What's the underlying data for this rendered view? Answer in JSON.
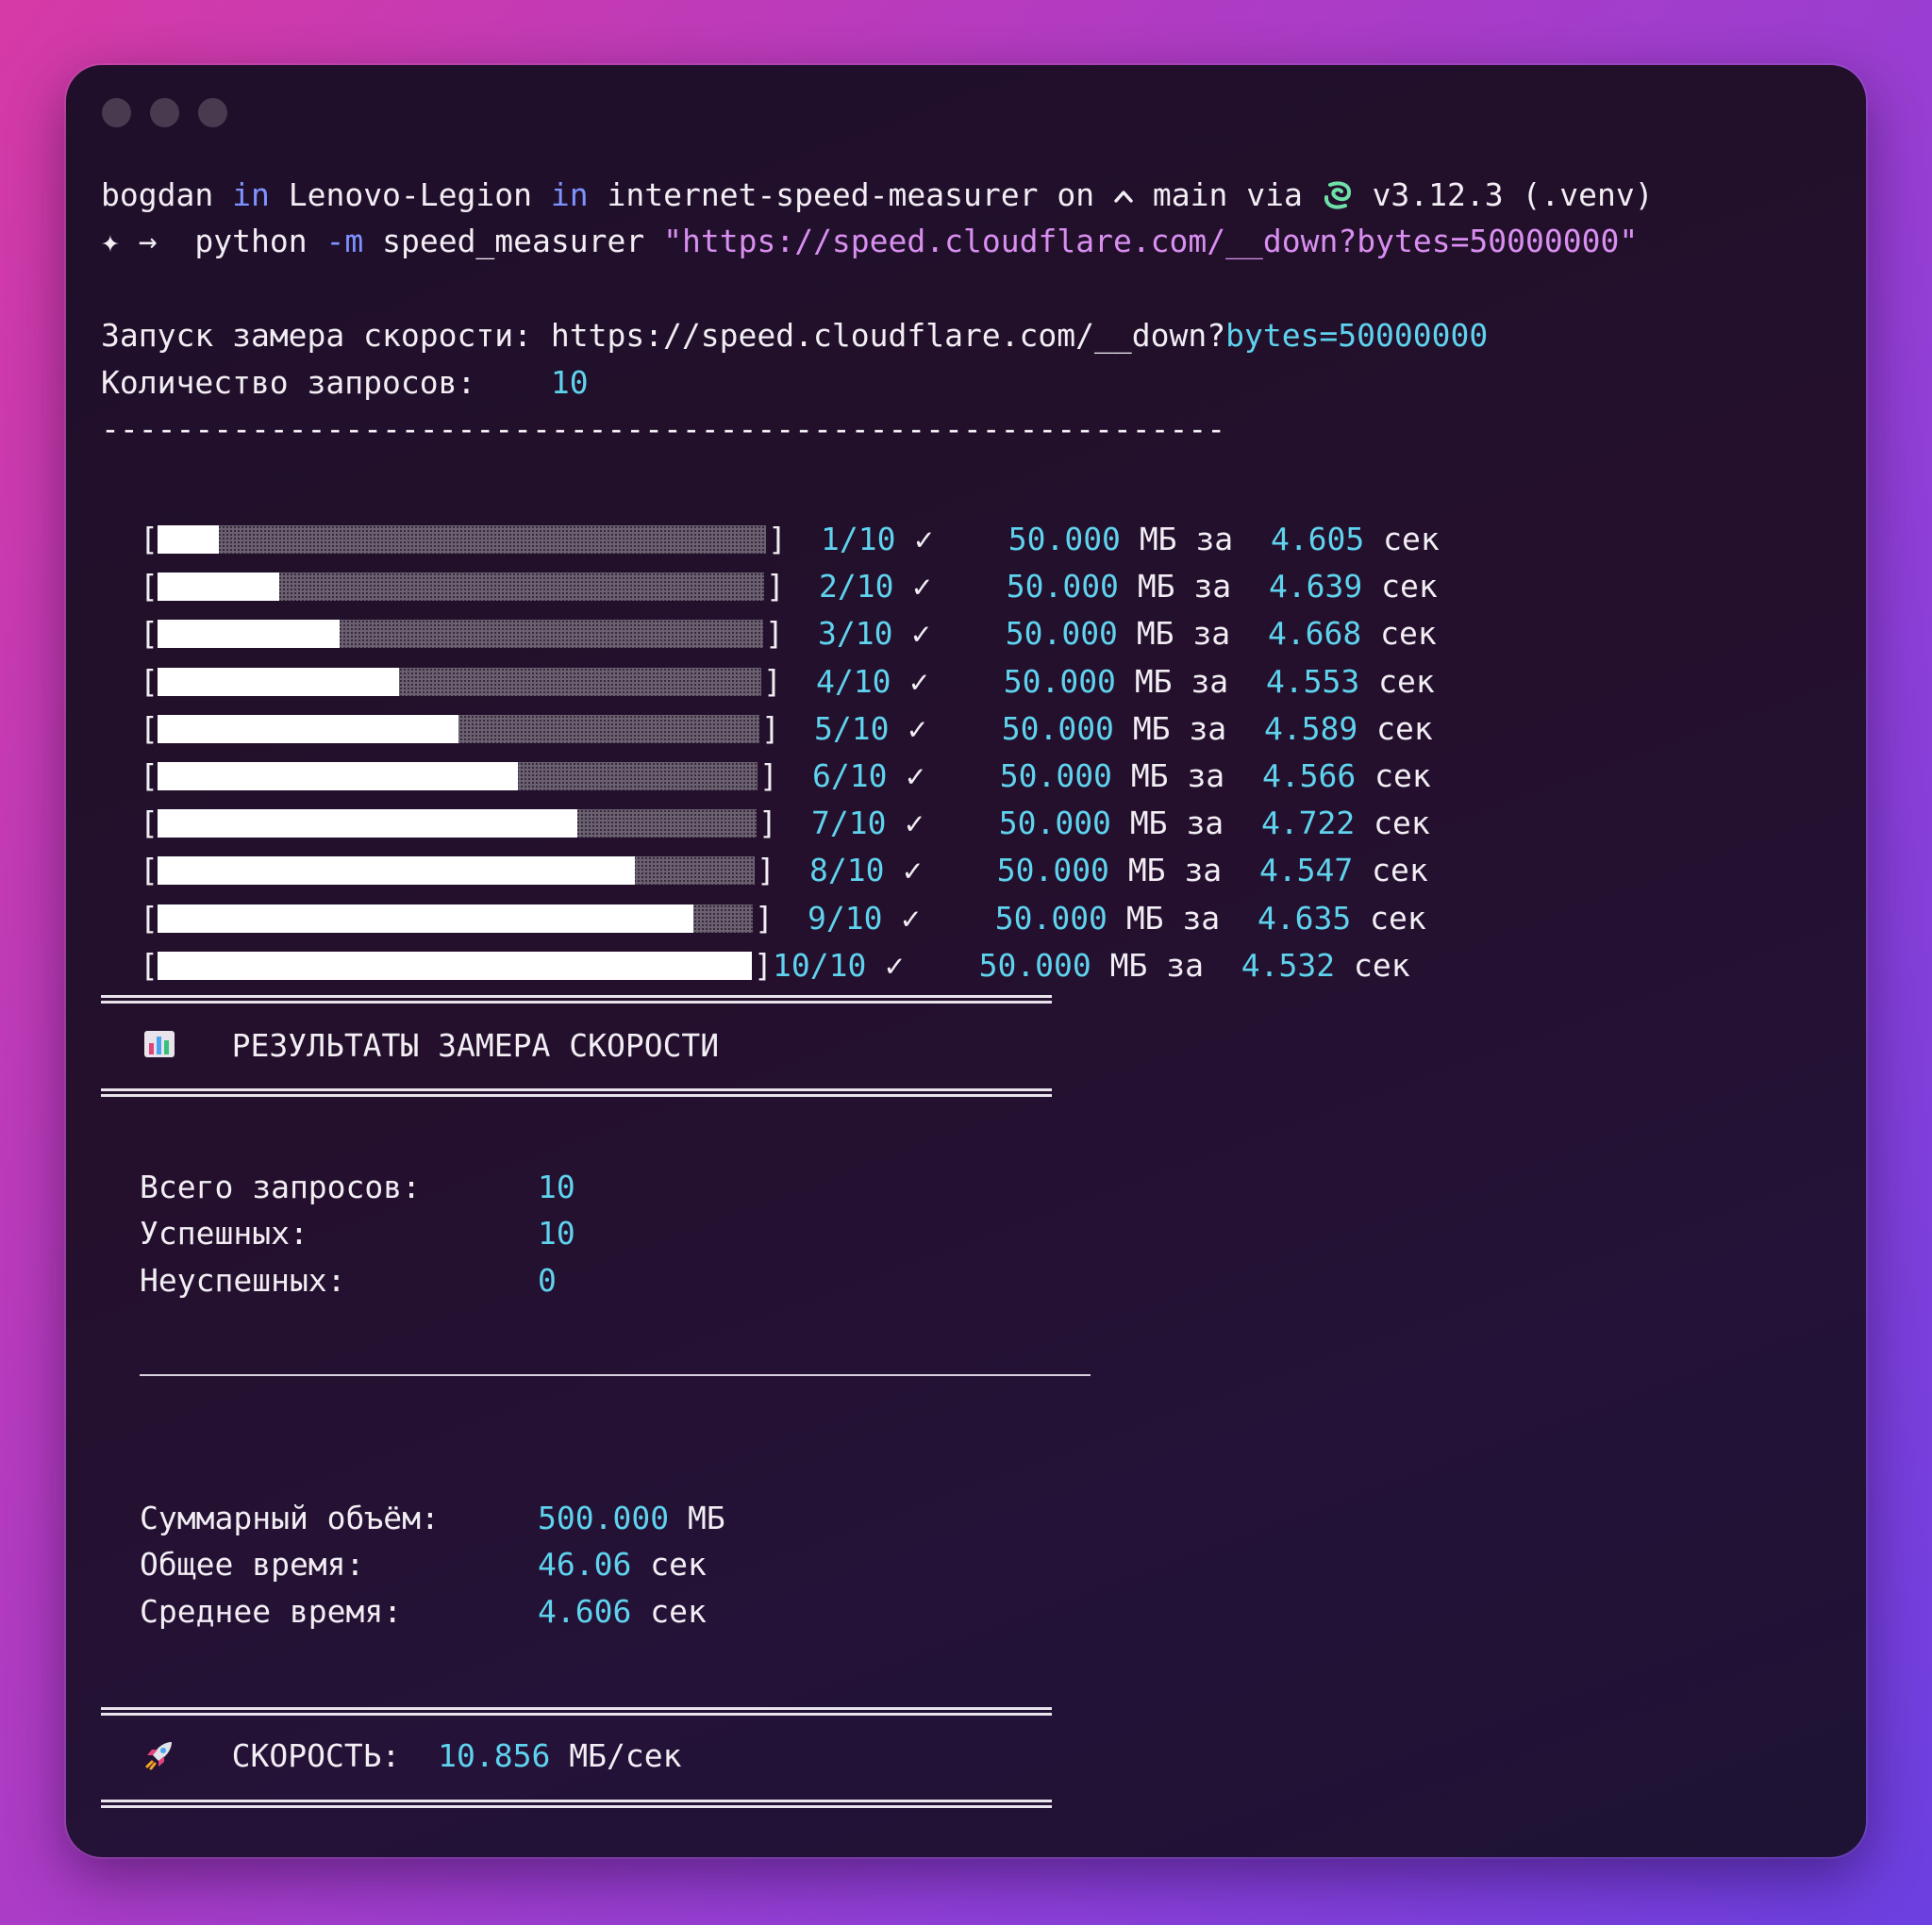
{
  "prompt": {
    "user": "bogdan",
    "in1": "in",
    "host": "Lenovo-Legion",
    "in2": "in",
    "dir": "internet-speed-measurer",
    "on": "on",
    "branch_icon": "git-branch-icon",
    "branch": "main",
    "via": "via",
    "python_icon": "python-icon",
    "python_version": "v3.12.3",
    "venv": "(.venv)",
    "symbol1": "✦",
    "symbol2": "→"
  },
  "command": {
    "program": "python",
    "flag": "-m",
    "module": "speed_measurer",
    "url": "\"https://speed.cloudflare.com/__down?bytes=50000000\""
  },
  "info": {
    "start_label": "Запуск замера скорости:",
    "url_base": "https://speed.cloudflare.com/__down?",
    "url_param": "bytes=50000000",
    "count_label": "Количество запросов:",
    "count_value": "10",
    "separator": "------------------------------------------------------------"
  },
  "rows": [
    {
      "progress": 0.1,
      "step": "1/10",
      "check": "✓",
      "size": "50.000",
      "size_unit": "МБ",
      "za": "за",
      "time": "4.605",
      "time_unit": "сек"
    },
    {
      "progress": 0.2,
      "step": "2/10",
      "check": "✓",
      "size": "50.000",
      "size_unit": "МБ",
      "za": "за",
      "time": "4.639",
      "time_unit": "сек"
    },
    {
      "progress": 0.3,
      "step": "3/10",
      "check": "✓",
      "size": "50.000",
      "size_unit": "МБ",
      "za": "за",
      "time": "4.668",
      "time_unit": "сек"
    },
    {
      "progress": 0.4,
      "step": "4/10",
      "check": "✓",
      "size": "50.000",
      "size_unit": "МБ",
      "za": "за",
      "time": "4.553",
      "time_unit": "сек"
    },
    {
      "progress": 0.5,
      "step": "5/10",
      "check": "✓",
      "size": "50.000",
      "size_unit": "МБ",
      "za": "за",
      "time": "4.589",
      "time_unit": "сек"
    },
    {
      "progress": 0.6,
      "step": "6/10",
      "check": "✓",
      "size": "50.000",
      "size_unit": "МБ",
      "za": "за",
      "time": "4.566",
      "time_unit": "сек"
    },
    {
      "progress": 0.7,
      "step": "7/10",
      "check": "✓",
      "size": "50.000",
      "size_unit": "МБ",
      "za": "за",
      "time": "4.722",
      "time_unit": "сек"
    },
    {
      "progress": 0.8,
      "step": "8/10",
      "check": "✓",
      "size": "50.000",
      "size_unit": "МБ",
      "za": "за",
      "time": "4.547",
      "time_unit": "сек"
    },
    {
      "progress": 0.9,
      "step": "9/10",
      "check": "✓",
      "size": "50.000",
      "size_unit": "МБ",
      "za": "за",
      "time": "4.635",
      "time_unit": "сек"
    },
    {
      "progress": 1.0,
      "step": "10/10",
      "check": "✓",
      "size": "50.000",
      "size_unit": "МБ",
      "za": "за",
      "time": "4.532",
      "time_unit": "сек"
    }
  ],
  "results": {
    "icon": "bar-chart-icon",
    "title": "РЕЗУЛЬТАТЫ ЗАМЕРА СКОРОСТИ",
    "total_label": "Всего запросов:",
    "total_value": "10",
    "success_label": "Успешных:",
    "success_value": "10",
    "fail_label": "Неуспешных:",
    "fail_value": "0",
    "volume_label": "Суммарный объём:",
    "volume_value": "500.000",
    "volume_unit": "МБ",
    "time_label": "Общее время:",
    "time_value": "46.06",
    "time_unit": "сек",
    "avg_label": "Среднее время:",
    "avg_value": "4.606",
    "avg_unit": "сек"
  },
  "speed": {
    "icon": "rocket-icon",
    "label": "СКОРОСТЬ:",
    "value": "10.856",
    "unit": "МБ/сек"
  },
  "colors": {
    "accent_cyan": "#5fd3ee",
    "accent_blue": "#7e93ff",
    "accent_pink": "#e0447a",
    "string_violet": "#d98ff0"
  }
}
